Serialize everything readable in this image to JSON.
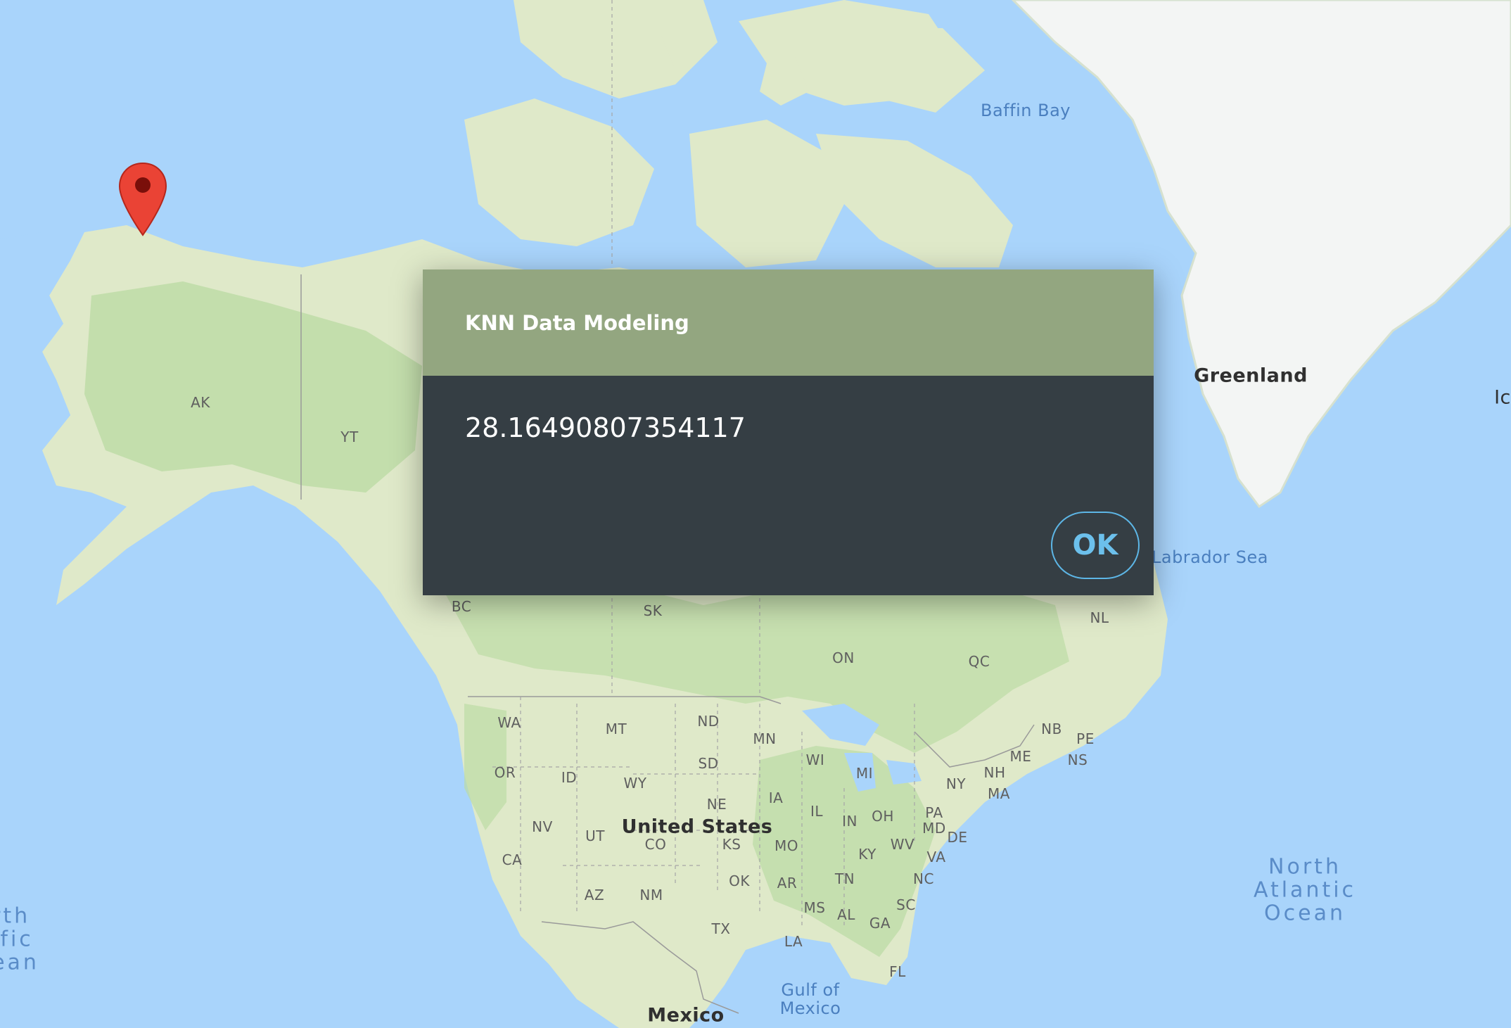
{
  "dialog": {
    "title": "KNN Data Modeling",
    "message": "28.16490807354117",
    "ok_label": "OK"
  },
  "map": {
    "water_labels": [
      "Baffin Bay",
      "Labrador Sea",
      "Gulf of\nMexico"
    ],
    "ocean_labels": [
      "North\nAtlantic\nOcean",
      "rth\nific\nean"
    ],
    "countries": [
      "Greenland",
      "United States",
      "Mexico",
      "Ic"
    ],
    "regions": [
      "AK",
      "YT",
      "BC",
      "SK",
      "ON",
      "QC",
      "NL",
      "WA",
      "MT",
      "ND",
      "MN",
      "OR",
      "ID",
      "WY",
      "SD",
      "WI",
      "MI",
      "NE",
      "IA",
      "IL",
      "NV",
      "UT",
      "CO",
      "KS",
      "MO",
      "IN",
      "OH",
      "CA",
      "AZ",
      "NM",
      "OK",
      "AR",
      "TN",
      "KY",
      "WV",
      "VA",
      "NC",
      "SC",
      "GA",
      "AL",
      "MS",
      "LA",
      "TX",
      "FL",
      "NY",
      "PA",
      "MD",
      "DE",
      "NH",
      "MA",
      "ME",
      "NB",
      "PE",
      "NS"
    ]
  },
  "colors": {
    "water": "#a9d4fb",
    "land": "#dfe9c9",
    "forest": "#bcdba5",
    "ice": "#f5f7f8",
    "dialog_header": "#93a680",
    "dialog_body": "#353e44",
    "accent": "#5db6e6",
    "marker": "#ea4335"
  },
  "icons": {
    "marker": "map-pin-icon"
  }
}
